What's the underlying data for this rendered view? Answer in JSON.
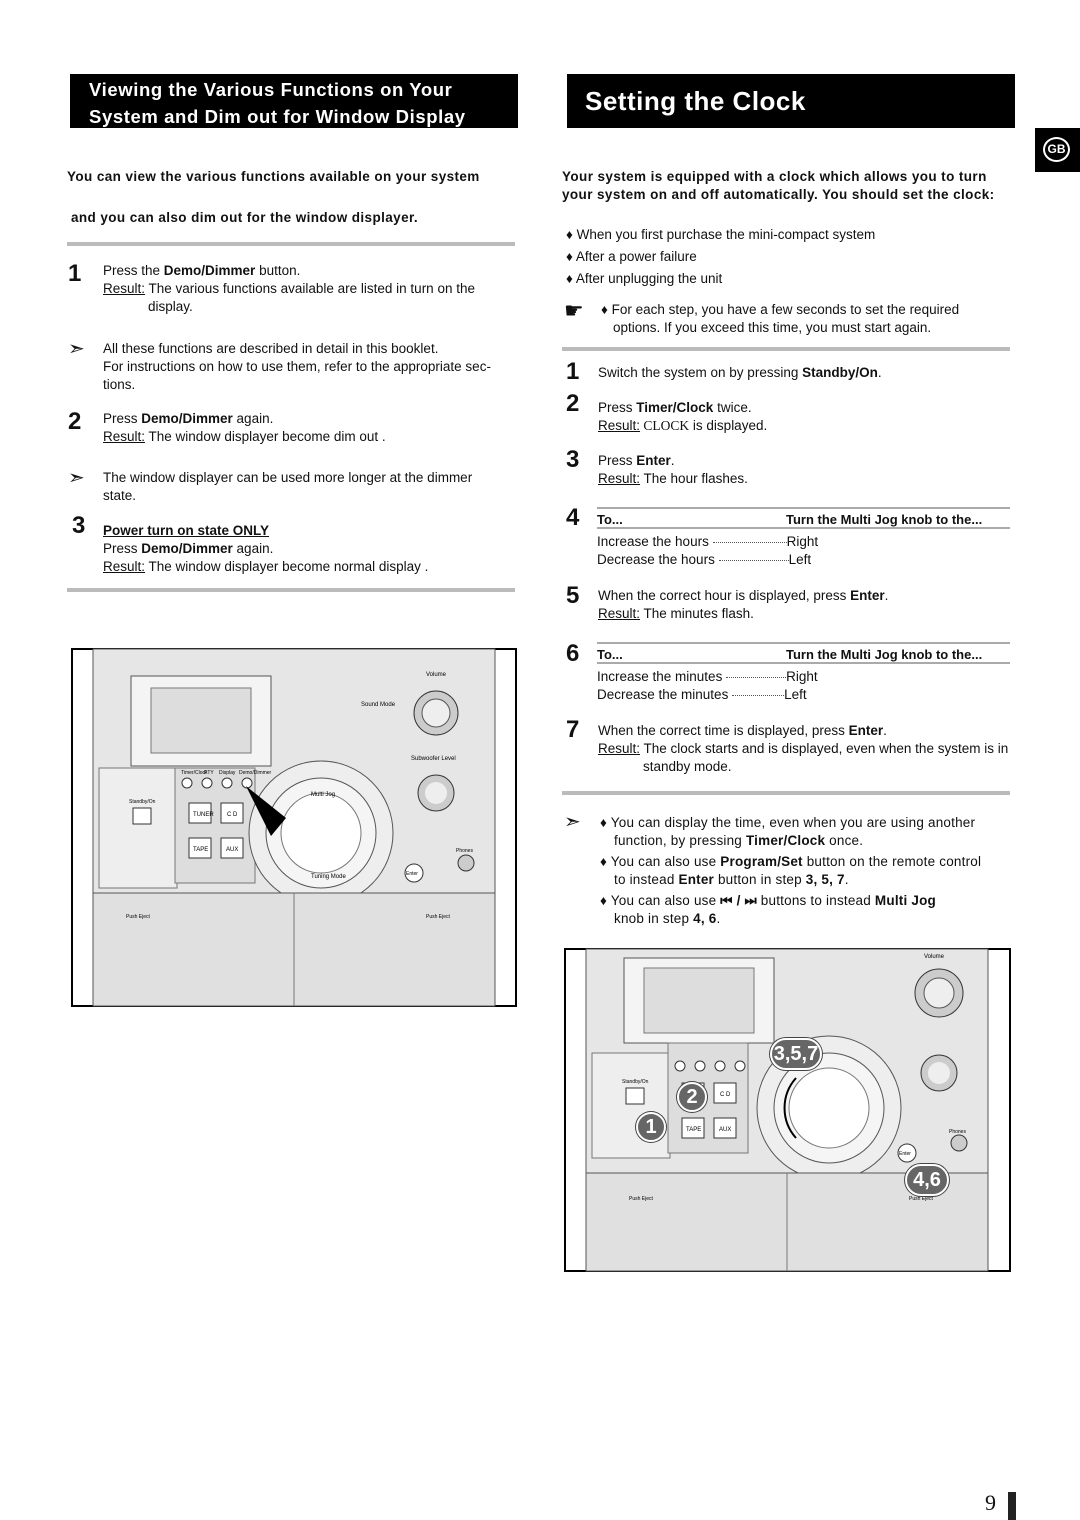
{
  "left": {
    "title_line1": "Viewing the Various Functions on Your",
    "title_line2": "System and Dim out for Window Display",
    "intro_line1": "You can view the various functions available on your system",
    "intro_line2": "and you can also dim out for the window displayer.",
    "step1": {
      "num": "1",
      "pre": "Press the ",
      "bold": "Demo/Dimmer",
      "post": " button.",
      "result_label": "Result:",
      "result": " The various functions available are listed in turn on the",
      "result2": "display."
    },
    "note1": {
      "line1": "All these functions are described in detail in this booklet.",
      "line2": "For instructions on how to use them, refer to the appropriate sec-",
      "line3": "tions."
    },
    "step2": {
      "num": "2",
      "pre": "Press ",
      "bold": "Demo/Dimmer",
      "post": " again.",
      "result_label": "Result:",
      "result": " The window displayer become dim out ."
    },
    "note2": {
      "line1": "The window displayer can be used more longer at the dimmer",
      "line2": "state."
    },
    "step3": {
      "num": "3",
      "heading": "Power turn on state ONLY",
      "pre": "Press ",
      "bold": "Demo/Dimmer",
      "post": " again.",
      "result_label": "Result:",
      "result": " The window displayer become normal display ."
    }
  },
  "right": {
    "title": "Setting the Clock",
    "badge": "GB",
    "intro": "Your system is equipped with a clock which allows you to turn your system on and off automatically. You should set the clock:",
    "bullets": [
      "When you first purchase the mini-compact system",
      "After a power failure",
      "After unplugging the unit"
    ],
    "hand_note_line1": "For each step, you have a few seconds to set the required",
    "hand_note_line2": "options. If you exceed this time, you must start again.",
    "step1": {
      "num": "1",
      "pre": "Switch the system on by pressing ",
      "bold": "Standby/On",
      "post": "."
    },
    "step2": {
      "num": "2",
      "pre": "Press ",
      "bold": "Timer/Clock",
      "post": " twice.",
      "result_label": "Result:",
      "result_bold": " CLOCK",
      "result": " is displayed."
    },
    "step3": {
      "num": "3",
      "pre": "Press ",
      "bold": "Enter",
      "post": ".",
      "result_label": "Result:",
      "result": " The hour flashes."
    },
    "step4": {
      "num": "4",
      "col1": "To...",
      "col2": "Turn the Multi Jog knob to the...",
      "rows": [
        {
          "to": "Increase the hours",
          "dir": "Right"
        },
        {
          "to": "Decrease the hours",
          "dir": "Left"
        }
      ]
    },
    "step5": {
      "num": "5",
      "pre": "When the correct hour is displayed, press ",
      "bold": "Enter",
      "post": ".",
      "result_label": "Result:",
      "result": " The minutes flash."
    },
    "step6": {
      "num": "6",
      "col1": "To...",
      "col2": "Turn the Multi Jog knob to the...",
      "rows": [
        {
          "to": "Increase the minutes",
          "dir": "Right"
        },
        {
          "to": "Decrease the minutes",
          "dir": "Left"
        }
      ]
    },
    "step7": {
      "num": "7",
      "pre": "When the correct time is displayed, press ",
      "bold": "Enter",
      "post": ".",
      "result_label": "Result:",
      "result": " The clock starts and is displayed, even when the system is in",
      "result2": "standby mode."
    },
    "tips": [
      {
        "a": "You can display the time, even when you are using another",
        "b": "function, by pressing ",
        "bold": "Timer/Clock",
        "c": " once."
      },
      {
        "a": "You can also use ",
        "bold": "Program/Set",
        "b": " button on the remote control",
        "c": "to instead ",
        "bold2": "Enter",
        "d": " button in step ",
        "steps": "3, 5, 7",
        "e": "."
      },
      {
        "a": "You can also use ",
        "icons": "⏮ / ⏭",
        "b": " buttons to instead ",
        "bold": "Multi Jog",
        "c": "knob in step ",
        "steps": "4, 6",
        "d": "."
      }
    ],
    "callouts": [
      "3,5,7",
      "2",
      "1",
      "4,6"
    ]
  },
  "device": {
    "volume": "Volume",
    "sound_mode": "Sound Mode",
    "subwoofer": "Subwoofer Level",
    "timer": "Timer/Clock",
    "pty": "PTY",
    "display": "Display",
    "demo": "Demo/Dimmer",
    "standby": "Standby/On",
    "tuner": "TUNER",
    "cd": "C D",
    "tape": "TAPE",
    "aux": "AUX",
    "enter": "Enter",
    "phones": "Phones",
    "multi_jog": "Multi Jog",
    "tuning_mode": "Tuning Mode",
    "push_eject": "Push Eject"
  },
  "page_number": "9"
}
